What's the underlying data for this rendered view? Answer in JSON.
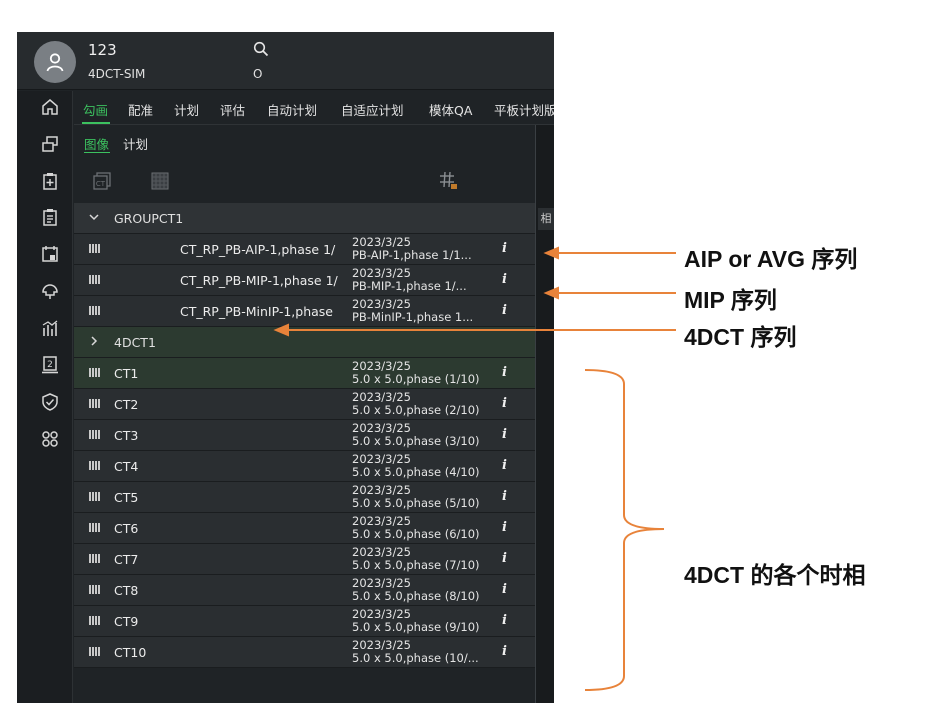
{
  "header": {
    "patient_id": "123",
    "patient_name": "4DCT-SIM",
    "o_label": "O"
  },
  "tabs": [
    "勾画",
    "配准",
    "计划",
    "评估",
    "自动计划",
    "自适应计划",
    "模体QA",
    "平板计划版"
  ],
  "subtabs": [
    "图像",
    "计划"
  ],
  "side_tab": "相",
  "groups": [
    {
      "label": "GROUPCT1",
      "expanded": true
    },
    {
      "label": "4DCT1",
      "expanded": false
    }
  ],
  "group_rows": [
    {
      "name": "CT_RP_PB-AIP-1,phase 1/",
      "date": "2023/3/25",
      "desc": "PB-AIP-1,phase 1/1..."
    },
    {
      "name": "CT_RP_PB-MIP-1,phase 1/",
      "date": "2023/3/25",
      "desc": "PB-MIP-1,phase 1/..."
    },
    {
      "name": "CT_RP_PB-MinIP-1,phase",
      "date": "2023/3/25",
      "desc": "PB-MinIP-1,phase 1..."
    }
  ],
  "phase_rows": [
    {
      "name": "CT1",
      "date": "2023/3/25",
      "desc": "5.0 x 5.0,phase (1/10)"
    },
    {
      "name": "CT2",
      "date": "2023/3/25",
      "desc": "5.0 x 5.0,phase (2/10)"
    },
    {
      "name": "CT3",
      "date": "2023/3/25",
      "desc": "5.0 x 5.0,phase (3/10)"
    },
    {
      "name": "CT4",
      "date": "2023/3/25",
      "desc": "5.0 x 5.0,phase (4/10)"
    },
    {
      "name": "CT5",
      "date": "2023/3/25",
      "desc": "5.0 x 5.0,phase (5/10)"
    },
    {
      "name": "CT6",
      "date": "2023/3/25",
      "desc": "5.0 x 5.0,phase (6/10)"
    },
    {
      "name": "CT7",
      "date": "2023/3/25",
      "desc": "5.0 x 5.0,phase (7/10)"
    },
    {
      "name": "CT8",
      "date": "2023/3/25",
      "desc": "5.0 x 5.0,phase (8/10)"
    },
    {
      "name": "CT9",
      "date": "2023/3/25",
      "desc": "5.0 x 5.0,phase (9/10)"
    },
    {
      "name": "CT10",
      "date": "2023/3/25",
      "desc": "5.0 x 5.0,phase (10/..."
    }
  ],
  "info_glyph": "i",
  "annotations": {
    "aip": "AIP or AVG 序列",
    "mip": "MIP 序列",
    "fourdct": "4DCT 序列",
    "phases": "4DCT 的各个时相"
  },
  "colors": {
    "accent_green": "#3cc15f",
    "annotation_orange": "#e8833a",
    "panel_bg": "#2a2e31"
  },
  "icons": [
    "home-icon",
    "layers-icon",
    "clipboard-plus-icon",
    "clipboard-list-icon",
    "calendar-icon",
    "beam-icon",
    "chart-icon",
    "report-icon",
    "shield-icon",
    "command-icon"
  ]
}
